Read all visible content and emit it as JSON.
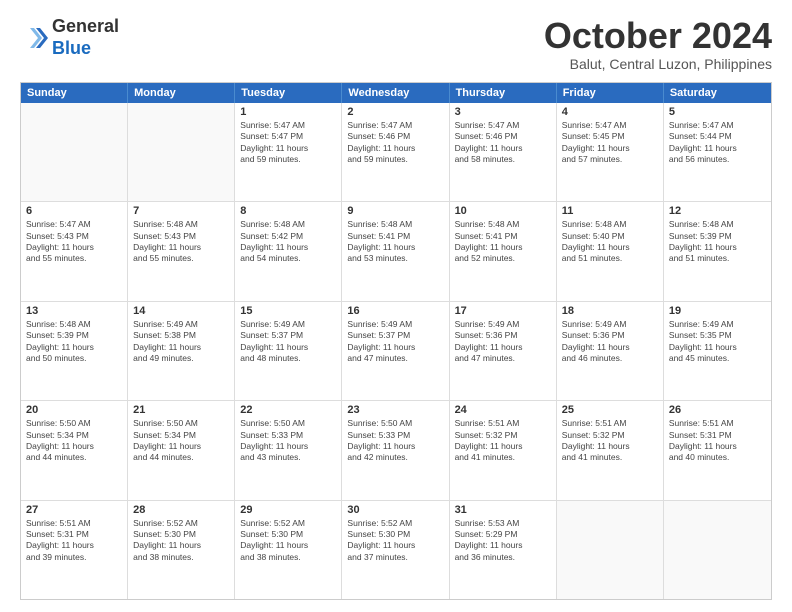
{
  "header": {
    "logo_line1": "General",
    "logo_line2": "Blue",
    "month": "October 2024",
    "location": "Balut, Central Luzon, Philippines"
  },
  "weekdays": [
    "Sunday",
    "Monday",
    "Tuesday",
    "Wednesday",
    "Thursday",
    "Friday",
    "Saturday"
  ],
  "rows": [
    [
      {
        "day": "",
        "lines": [],
        "empty": true
      },
      {
        "day": "",
        "lines": [],
        "empty": true
      },
      {
        "day": "1",
        "lines": [
          "Sunrise: 5:47 AM",
          "Sunset: 5:47 PM",
          "Daylight: 11 hours",
          "and 59 minutes."
        ]
      },
      {
        "day": "2",
        "lines": [
          "Sunrise: 5:47 AM",
          "Sunset: 5:46 PM",
          "Daylight: 11 hours",
          "and 59 minutes."
        ]
      },
      {
        "day": "3",
        "lines": [
          "Sunrise: 5:47 AM",
          "Sunset: 5:46 PM",
          "Daylight: 11 hours",
          "and 58 minutes."
        ]
      },
      {
        "day": "4",
        "lines": [
          "Sunrise: 5:47 AM",
          "Sunset: 5:45 PM",
          "Daylight: 11 hours",
          "and 57 minutes."
        ]
      },
      {
        "day": "5",
        "lines": [
          "Sunrise: 5:47 AM",
          "Sunset: 5:44 PM",
          "Daylight: 11 hours",
          "and 56 minutes."
        ]
      }
    ],
    [
      {
        "day": "6",
        "lines": [
          "Sunrise: 5:47 AM",
          "Sunset: 5:43 PM",
          "Daylight: 11 hours",
          "and 55 minutes."
        ]
      },
      {
        "day": "7",
        "lines": [
          "Sunrise: 5:48 AM",
          "Sunset: 5:43 PM",
          "Daylight: 11 hours",
          "and 55 minutes."
        ]
      },
      {
        "day": "8",
        "lines": [
          "Sunrise: 5:48 AM",
          "Sunset: 5:42 PM",
          "Daylight: 11 hours",
          "and 54 minutes."
        ]
      },
      {
        "day": "9",
        "lines": [
          "Sunrise: 5:48 AM",
          "Sunset: 5:41 PM",
          "Daylight: 11 hours",
          "and 53 minutes."
        ]
      },
      {
        "day": "10",
        "lines": [
          "Sunrise: 5:48 AM",
          "Sunset: 5:41 PM",
          "Daylight: 11 hours",
          "and 52 minutes."
        ]
      },
      {
        "day": "11",
        "lines": [
          "Sunrise: 5:48 AM",
          "Sunset: 5:40 PM",
          "Daylight: 11 hours",
          "and 51 minutes."
        ]
      },
      {
        "day": "12",
        "lines": [
          "Sunrise: 5:48 AM",
          "Sunset: 5:39 PM",
          "Daylight: 11 hours",
          "and 51 minutes."
        ]
      }
    ],
    [
      {
        "day": "13",
        "lines": [
          "Sunrise: 5:48 AM",
          "Sunset: 5:39 PM",
          "Daylight: 11 hours",
          "and 50 minutes."
        ]
      },
      {
        "day": "14",
        "lines": [
          "Sunrise: 5:49 AM",
          "Sunset: 5:38 PM",
          "Daylight: 11 hours",
          "and 49 minutes."
        ]
      },
      {
        "day": "15",
        "lines": [
          "Sunrise: 5:49 AM",
          "Sunset: 5:37 PM",
          "Daylight: 11 hours",
          "and 48 minutes."
        ]
      },
      {
        "day": "16",
        "lines": [
          "Sunrise: 5:49 AM",
          "Sunset: 5:37 PM",
          "Daylight: 11 hours",
          "and 47 minutes."
        ]
      },
      {
        "day": "17",
        "lines": [
          "Sunrise: 5:49 AM",
          "Sunset: 5:36 PM",
          "Daylight: 11 hours",
          "and 47 minutes."
        ]
      },
      {
        "day": "18",
        "lines": [
          "Sunrise: 5:49 AM",
          "Sunset: 5:36 PM",
          "Daylight: 11 hours",
          "and 46 minutes."
        ]
      },
      {
        "day": "19",
        "lines": [
          "Sunrise: 5:49 AM",
          "Sunset: 5:35 PM",
          "Daylight: 11 hours",
          "and 45 minutes."
        ]
      }
    ],
    [
      {
        "day": "20",
        "lines": [
          "Sunrise: 5:50 AM",
          "Sunset: 5:34 PM",
          "Daylight: 11 hours",
          "and 44 minutes."
        ]
      },
      {
        "day": "21",
        "lines": [
          "Sunrise: 5:50 AM",
          "Sunset: 5:34 PM",
          "Daylight: 11 hours",
          "and 44 minutes."
        ]
      },
      {
        "day": "22",
        "lines": [
          "Sunrise: 5:50 AM",
          "Sunset: 5:33 PM",
          "Daylight: 11 hours",
          "and 43 minutes."
        ]
      },
      {
        "day": "23",
        "lines": [
          "Sunrise: 5:50 AM",
          "Sunset: 5:33 PM",
          "Daylight: 11 hours",
          "and 42 minutes."
        ]
      },
      {
        "day": "24",
        "lines": [
          "Sunrise: 5:51 AM",
          "Sunset: 5:32 PM",
          "Daylight: 11 hours",
          "and 41 minutes."
        ]
      },
      {
        "day": "25",
        "lines": [
          "Sunrise: 5:51 AM",
          "Sunset: 5:32 PM",
          "Daylight: 11 hours",
          "and 41 minutes."
        ]
      },
      {
        "day": "26",
        "lines": [
          "Sunrise: 5:51 AM",
          "Sunset: 5:31 PM",
          "Daylight: 11 hours",
          "and 40 minutes."
        ]
      }
    ],
    [
      {
        "day": "27",
        "lines": [
          "Sunrise: 5:51 AM",
          "Sunset: 5:31 PM",
          "Daylight: 11 hours",
          "and 39 minutes."
        ]
      },
      {
        "day": "28",
        "lines": [
          "Sunrise: 5:52 AM",
          "Sunset: 5:30 PM",
          "Daylight: 11 hours",
          "and 38 minutes."
        ]
      },
      {
        "day": "29",
        "lines": [
          "Sunrise: 5:52 AM",
          "Sunset: 5:30 PM",
          "Daylight: 11 hours",
          "and 38 minutes."
        ]
      },
      {
        "day": "30",
        "lines": [
          "Sunrise: 5:52 AM",
          "Sunset: 5:30 PM",
          "Daylight: 11 hours",
          "and 37 minutes."
        ]
      },
      {
        "day": "31",
        "lines": [
          "Sunrise: 5:53 AM",
          "Sunset: 5:29 PM",
          "Daylight: 11 hours",
          "and 36 minutes."
        ]
      },
      {
        "day": "",
        "lines": [],
        "empty": true
      },
      {
        "day": "",
        "lines": [],
        "empty": true
      }
    ]
  ]
}
